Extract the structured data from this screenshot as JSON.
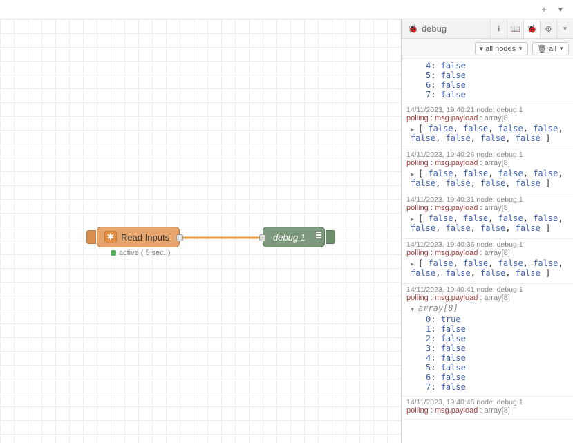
{
  "top": {
    "add": "+",
    "dropdown": "▼"
  },
  "sidebar": {
    "title": "debug",
    "filter": {
      "label": "all nodes",
      "trash_label": "all"
    },
    "icons": {
      "info": "i",
      "book": "📕",
      "bug": "🐞",
      "gear": "⚙",
      "caret": "▼"
    }
  },
  "canvas": {
    "inject_label": "Read Inputs",
    "inject_status": "active ( 5 sec. )",
    "debug_label": "debug 1"
  },
  "initial_items": [
    {
      "k": "4",
      "v": "false"
    },
    {
      "k": "5",
      "v": "false"
    },
    {
      "k": "6",
      "v": "false"
    },
    {
      "k": "7",
      "v": "false"
    }
  ],
  "messages": [
    {
      "ts": "14/11/2023, 19:40:21",
      "node": "node: debug 1",
      "topic": "polling",
      "path": "msg.payload",
      "type": "array[8]",
      "collapsed": true,
      "inline": [
        "false",
        "false",
        "false",
        "false",
        "false",
        "false",
        "false",
        "false"
      ]
    },
    {
      "ts": "14/11/2023, 19:40:26",
      "node": "node: debug 1",
      "topic": "polling",
      "path": "msg.payload",
      "type": "array[8]",
      "collapsed": true,
      "inline": [
        "false",
        "false",
        "false",
        "false",
        "false",
        "false",
        "false",
        "false"
      ]
    },
    {
      "ts": "14/11/2023, 19:40:31",
      "node": "node: debug 1",
      "topic": "polling",
      "path": "msg.payload",
      "type": "array[8]",
      "collapsed": true,
      "inline": [
        "false",
        "false",
        "false",
        "false",
        "false",
        "false",
        "false",
        "false"
      ]
    },
    {
      "ts": "14/11/2023, 19:40:36",
      "node": "node: debug 1",
      "topic": "polling",
      "path": "msg.payload",
      "type": "array[8]",
      "collapsed": true,
      "inline": [
        "false",
        "false",
        "false",
        "false",
        "false",
        "false",
        "false",
        "false"
      ]
    },
    {
      "ts": "14/11/2023, 19:40:41",
      "node": "node: debug 1",
      "topic": "polling",
      "path": "msg.payload",
      "type": "array[8]",
      "collapsed": false,
      "expanded_label": "array[8]",
      "items": [
        {
          "k": "0",
          "v": "true"
        },
        {
          "k": "1",
          "v": "false"
        },
        {
          "k": "2",
          "v": "false"
        },
        {
          "k": "3",
          "v": "false"
        },
        {
          "k": "4",
          "v": "false"
        },
        {
          "k": "5",
          "v": "false"
        },
        {
          "k": "6",
          "v": "false"
        },
        {
          "k": "7",
          "v": "false"
        }
      ]
    },
    {
      "ts": "14/11/2023, 19:40:46",
      "node": "node: debug 1",
      "topic": "polling",
      "path": "msg.payload",
      "type": "array[8]",
      "collapsed": true,
      "cut": true
    }
  ]
}
